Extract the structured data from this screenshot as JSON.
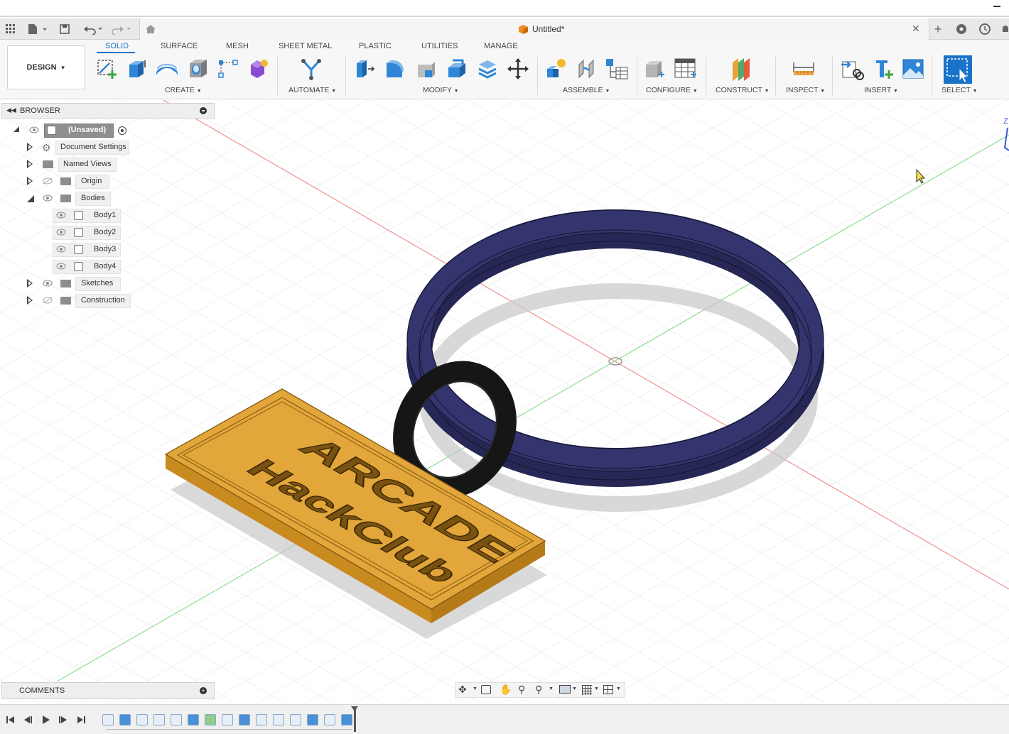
{
  "window": {
    "title": "Untitled*"
  },
  "workspace_button": {
    "label": "DESIGN"
  },
  "ribbon_tabs": [
    {
      "label": "SOLID",
      "active": true
    },
    {
      "label": "SURFACE"
    },
    {
      "label": "MESH"
    },
    {
      "label": "SHEET METAL"
    },
    {
      "label": "PLASTIC"
    },
    {
      "label": "UTILITIES"
    },
    {
      "label": "MANAGE"
    }
  ],
  "tool_groups": [
    {
      "label": "CREATE"
    },
    {
      "label": "AUTOMATE"
    },
    {
      "label": "MODIFY"
    },
    {
      "label": "ASSEMBLE"
    },
    {
      "label": "CONFIGURE"
    },
    {
      "label": "CONSTRUCT"
    },
    {
      "label": "INSPECT"
    },
    {
      "label": "INSERT"
    },
    {
      "label": "SELECT"
    }
  ],
  "browser": {
    "title": "BROWSER",
    "root": "(Unsaved)",
    "items": [
      {
        "label": "Document Settings"
      },
      {
        "label": "Named Views"
      },
      {
        "label": "Origin"
      },
      {
        "label": "Bodies"
      },
      {
        "label": "Body1"
      },
      {
        "label": "Body2"
      },
      {
        "label": "Body3"
      },
      {
        "label": "Body4"
      },
      {
        "label": "Sketches"
      },
      {
        "label": "Construction"
      }
    ]
  },
  "comments": {
    "label": "COMMENTS"
  },
  "model": {
    "tag_text_line1": "ARCADE",
    "tag_text_line2": "HackClub",
    "tag_color": "#e2a63a",
    "ring_color": "#2d2d62",
    "link_color": "#1c1c1c"
  },
  "axis": {
    "z_label": "Z"
  }
}
